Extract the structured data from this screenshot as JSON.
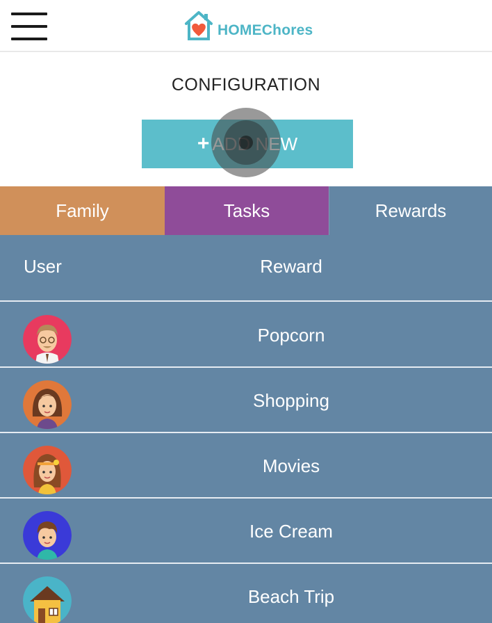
{
  "app": {
    "logo_text": "HOMEChores",
    "colors": {
      "brand": "#4db5c6",
      "heart": "#f15a3c",
      "add_button": "#5cbecb",
      "family_tab": "#d0905a",
      "tasks_tab": "#8f4c99",
      "rewards_tab": "#6386a4"
    }
  },
  "header": {
    "menu_icon": "hamburger-menu-icon"
  },
  "page": {
    "title": "CONFIGURATION"
  },
  "add_button": {
    "plus": "+",
    "label": "ADD NEW"
  },
  "tabs": [
    {
      "label": "Family"
    },
    {
      "label": "Tasks"
    },
    {
      "label": "Rewards",
      "active": true
    }
  ],
  "table": {
    "columns": {
      "user": "User",
      "reward": "Reward"
    },
    "rows": [
      {
        "avatar": "dad-avatar",
        "reward": "Popcorn"
      },
      {
        "avatar": "mom-avatar",
        "reward": "Shopping"
      },
      {
        "avatar": "girl-avatar",
        "reward": "Movies"
      },
      {
        "avatar": "boy-avatar",
        "reward": "Ice Cream"
      },
      {
        "avatar": "house-avatar",
        "reward": "Beach Trip"
      }
    ]
  }
}
